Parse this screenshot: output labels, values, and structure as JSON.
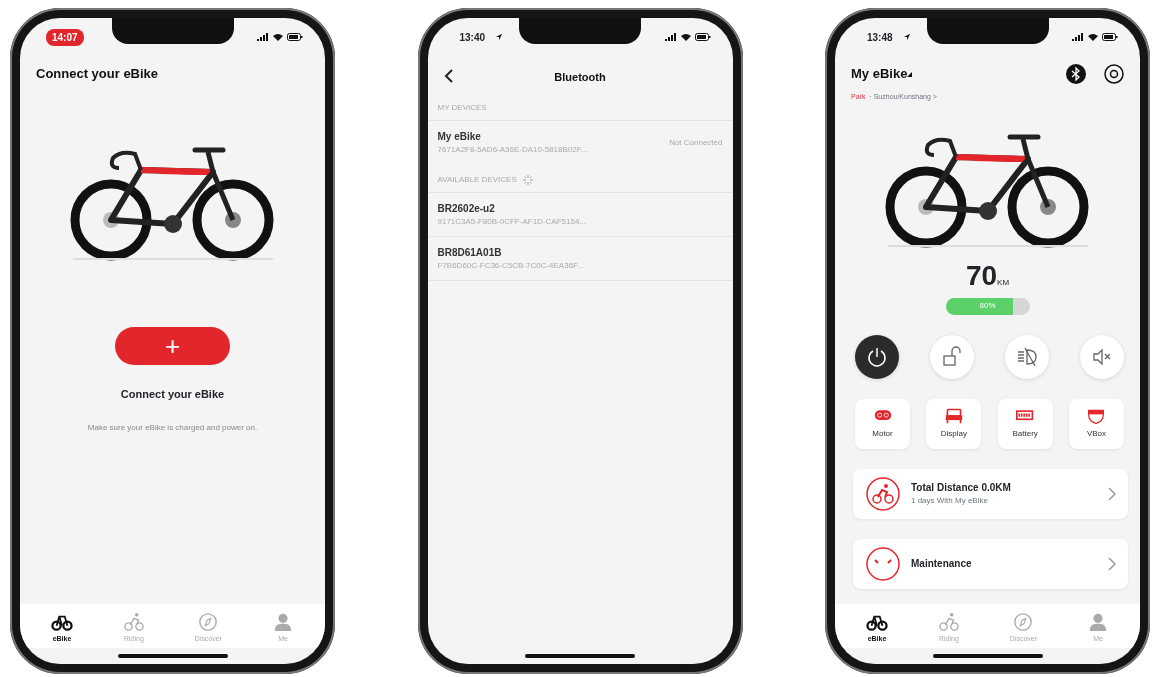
{
  "phones": [
    {
      "kind": "connect",
      "status_bar": {
        "time": "14:07",
        "time_highlighted": true,
        "location_arrow": false
      },
      "title": "Connect your eBike",
      "add_button": "+",
      "heading": "Connect your eBike",
      "hint": "Make sure your eBike is charged and power on.",
      "tab_bar": [
        {
          "kind": "bike",
          "label": "eBike",
          "selected": true
        },
        {
          "kind": "riding",
          "label": "Riding",
          "selected": false
        },
        {
          "kind": "discover",
          "label": "Discover",
          "selected": false
        },
        {
          "kind": "me",
          "label": "Me",
          "selected": false
        }
      ]
    },
    {
      "kind": "bluetooth",
      "status_bar": {
        "time": "13:40",
        "time_highlighted": false,
        "location_arrow": true
      },
      "title": "Bluetooth",
      "sections": [
        {
          "header": "MY DEVICES",
          "scanning": false,
          "devices": [
            {
              "name": "My eBike",
              "id": "7671A2F8-5AD6-A36E-DA10-5818B02F...",
              "status": "Not Connected"
            }
          ]
        },
        {
          "header": "AVAILABLE DEVICES",
          "scanning": true,
          "devices": [
            {
              "name": "BR2602e-u2",
              "id": "9171C3A5-F80B-0CFF-AF1D-CAF5154..."
            },
            {
              "name": "BR8D61A01B",
              "id": "F7B6D60C-FC36-C5CB-7C0C-4EA36F..."
            }
          ]
        }
      ]
    },
    {
      "kind": "dashboard",
      "status_bar": {
        "time": "13:48",
        "time_highlighted": false,
        "location_arrow": true
      },
      "title": "My eBike",
      "location_label": "Park",
      "location": "· Suzhou/Kunshang >",
      "range": "70",
      "range_unit": "KM",
      "battery": {
        "level": 0.8,
        "reading": "80%"
      },
      "controls": [
        {
          "kind": "power",
          "on": true
        },
        {
          "kind": "lock",
          "on": false
        },
        {
          "kind": "light",
          "on": false
        },
        {
          "kind": "mute",
          "on": false
        }
      ],
      "tiles": [
        {
          "kind": "motor",
          "label": "Motor"
        },
        {
          "kind": "display",
          "label": "Display"
        },
        {
          "kind": "battery",
          "label": "Battery"
        },
        {
          "kind": "vbox",
          "label": "VBox"
        }
      ],
      "cards": [
        {
          "kind": "distance",
          "title": "Total Distance 0.0KM",
          "subtitle": "1 days With My eBike"
        },
        {
          "kind": "maintenance",
          "title": "Maintenance"
        }
      ],
      "tab_bar": [
        {
          "kind": "bike",
          "label": "eBike",
          "selected": true
        },
        {
          "kind": "riding",
          "label": "Riding",
          "selected": false
        },
        {
          "kind": "discover",
          "label": "Discover",
          "selected": false
        },
        {
          "kind": "me",
          "label": "Me",
          "selected": false
        }
      ]
    }
  ]
}
